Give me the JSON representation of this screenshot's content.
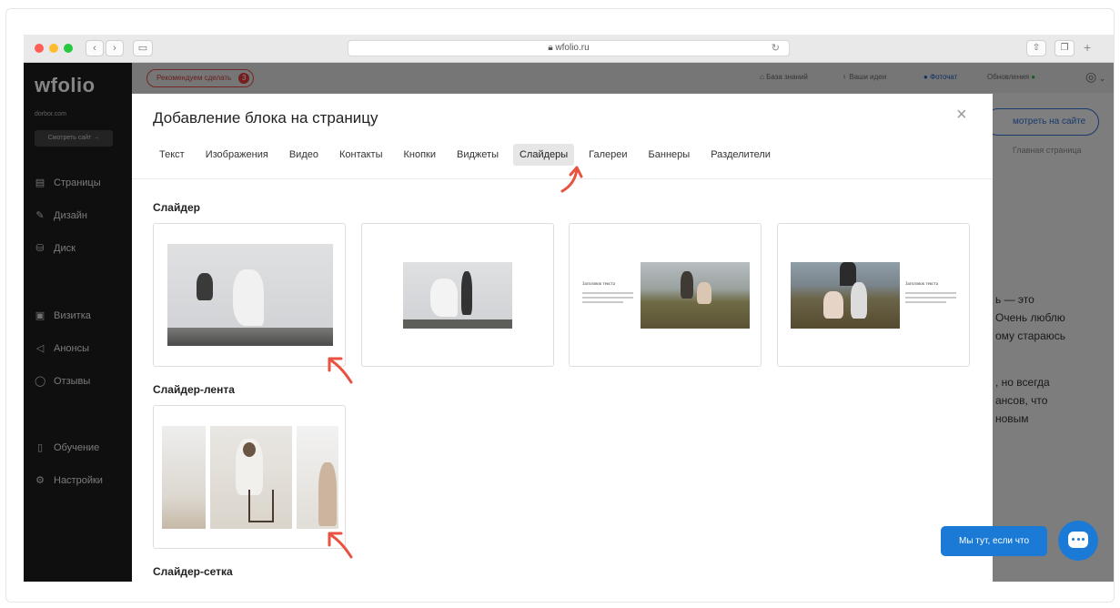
{
  "browser": {
    "url": "wfolio.ru",
    "lock_icon": "lock-icon"
  },
  "app": {
    "logo": "wfolio",
    "domain": "dorbor.com",
    "view_site_small": "Смотреть сайт →",
    "recommend_label": "Рекомендуем сделать",
    "recommend_count": "3",
    "top_links": {
      "knowledge": "База знаний",
      "ideas": "Ваши идеи",
      "photochat": "Фоточат",
      "updates": "Обновления"
    },
    "sidebar": {
      "pages": "Страницы",
      "design": "Дизайн",
      "disk": "Диск",
      "card": "Визитка",
      "announcements": "Анонсы",
      "reviews": "Отзывы",
      "learning": "Обучение",
      "settings": "Настройки"
    },
    "behind": {
      "view_site": "мотреть на сайте",
      "breadcrumb": "Главная страница",
      "text_lines": [
        "ь — это",
        "Очень люблю",
        "ому стараюсь",
        ", но всегда",
        "ансов, что",
        "новым"
      ]
    }
  },
  "modal": {
    "title": "Добавление блока на страницу",
    "close": "×",
    "tabs": [
      "Текст",
      "Изображения",
      "Видео",
      "Контакты",
      "Кнопки",
      "Виджеты",
      "Слайдеры",
      "Галереи",
      "Баннеры",
      "Разделители"
    ],
    "active_tab": "Слайдеры",
    "sections": {
      "slider": "Слайдер",
      "slider_strip": "Слайдер-лента",
      "slider_grid": "Слайдер-сетка"
    },
    "card_heading_text": "Заголовок текста"
  },
  "chat": {
    "label": "Мы тут, если что"
  },
  "colors": {
    "accent_blue": "#1b7ad6",
    "arrow_red": "#e8533f",
    "recommend_red": "#e03a3a"
  }
}
